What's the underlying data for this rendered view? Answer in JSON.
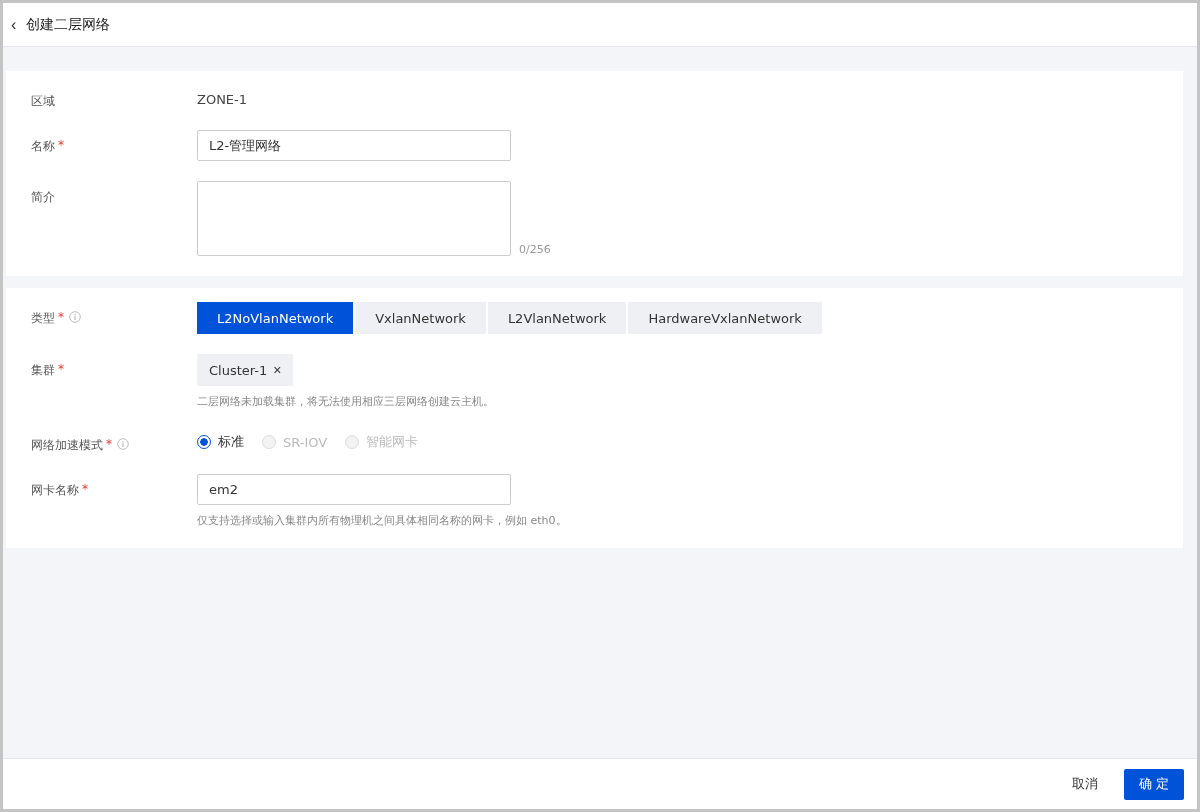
{
  "header": {
    "back": "‹",
    "title": "创建二层网络"
  },
  "section_1": {
    "rows": [
      {
        "kind": "text",
        "label": "区域",
        "value": "ZONE-1"
      },
      {
        "kind": "input",
        "label": "名称",
        "required_mark": "*",
        "value": "L2-管理网络"
      },
      {
        "kind": "textarea",
        "label": "简介",
        "counter": "0/256"
      }
    ]
  },
  "section_2": {
    "rows": [
      {
        "kind": "segmented",
        "label": "类型",
        "required_mark": "*",
        "info": true,
        "options": [
          {
            "label": "L2NoVlanNetwork",
            "selected": true
          },
          {
            "label": "VxlanNetwork",
            "selected": false
          },
          {
            "label": "L2VlanNetwork",
            "selected": false
          },
          {
            "label": "HardwareVxlanNetwork",
            "selected": false
          }
        ]
      },
      {
        "kind": "tags",
        "label": "集群",
        "required_mark": "*",
        "tags": [
          {
            "label": "Cluster-1",
            "remove": "×"
          }
        ],
        "hint": "二层网络未加载集群，将无法使用相应三层网络创建云主机。"
      },
      {
        "kind": "radio",
        "label": "网络加速模式",
        "required_mark": "*",
        "info": true,
        "options": [
          {
            "label": "标准",
            "selected": true,
            "disabled": false
          },
          {
            "label": "SR-IOV",
            "selected": false,
            "disabled": true
          },
          {
            "label": "智能网卡",
            "selected": false,
            "disabled": true
          }
        ]
      },
      {
        "kind": "input",
        "label": "网卡名称",
        "required_mark": "*",
        "value": "em2",
        "hint": "仅支持选择或输入集群内所有物理机之间具体相同名称的网卡，例如 eth0。"
      }
    ]
  },
  "footer": {
    "buttons": [
      {
        "label": "取消",
        "kind": "text"
      },
      {
        "label": "确 定",
        "kind": "primary"
      }
    ]
  }
}
